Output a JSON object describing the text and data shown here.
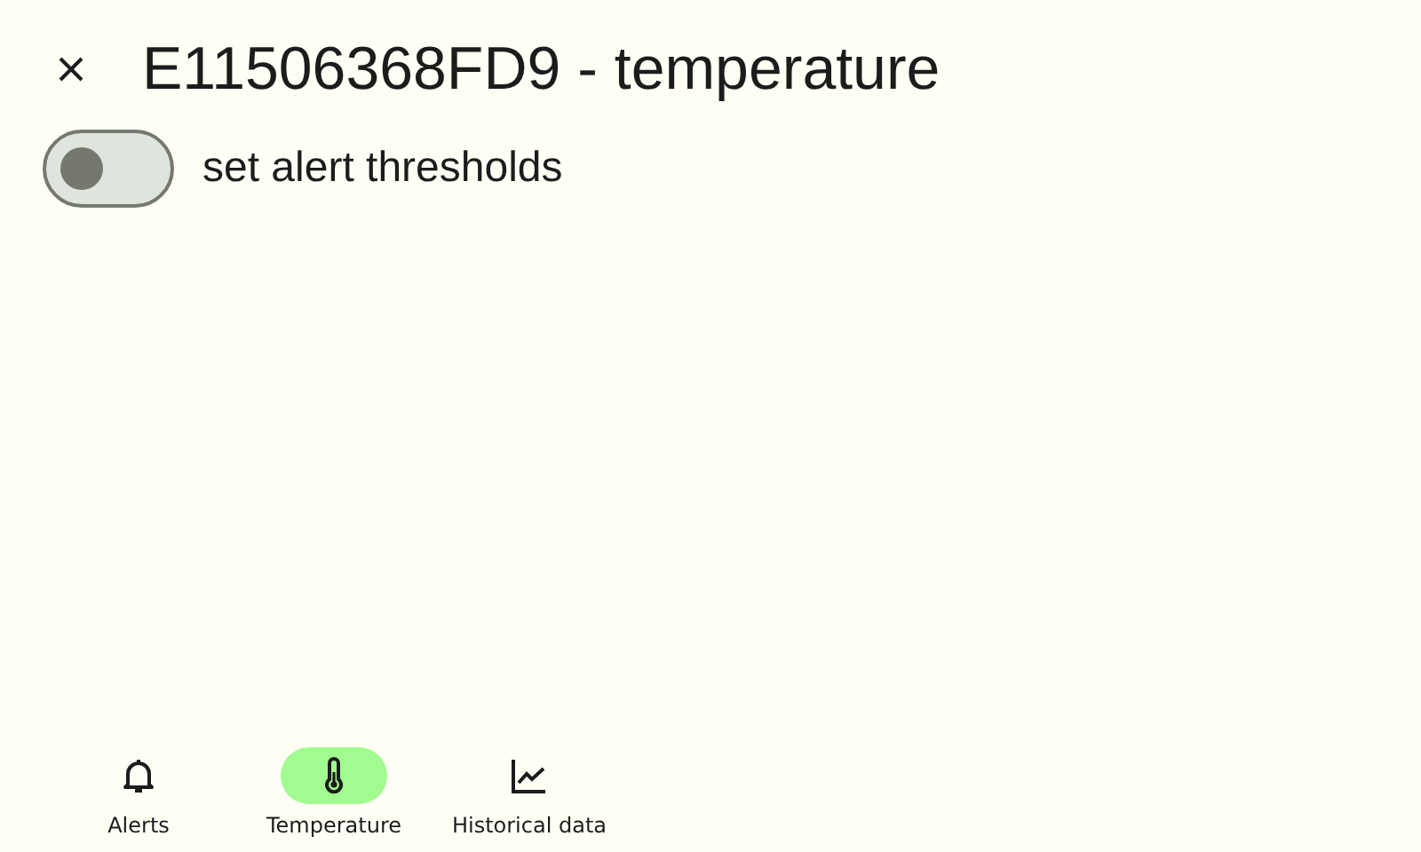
{
  "title": "E11506368FD9 - temperature",
  "alert_toggle": {
    "label": "set alert thresholds",
    "on": false
  },
  "nav": [
    {
      "kind": "bell",
      "label": "Alerts",
      "selected": false
    },
    {
      "kind": "thermometer",
      "label": "Temperature",
      "selected": true
    },
    {
      "kind": "chart",
      "label": "Historical data",
      "selected": false
    }
  ]
}
